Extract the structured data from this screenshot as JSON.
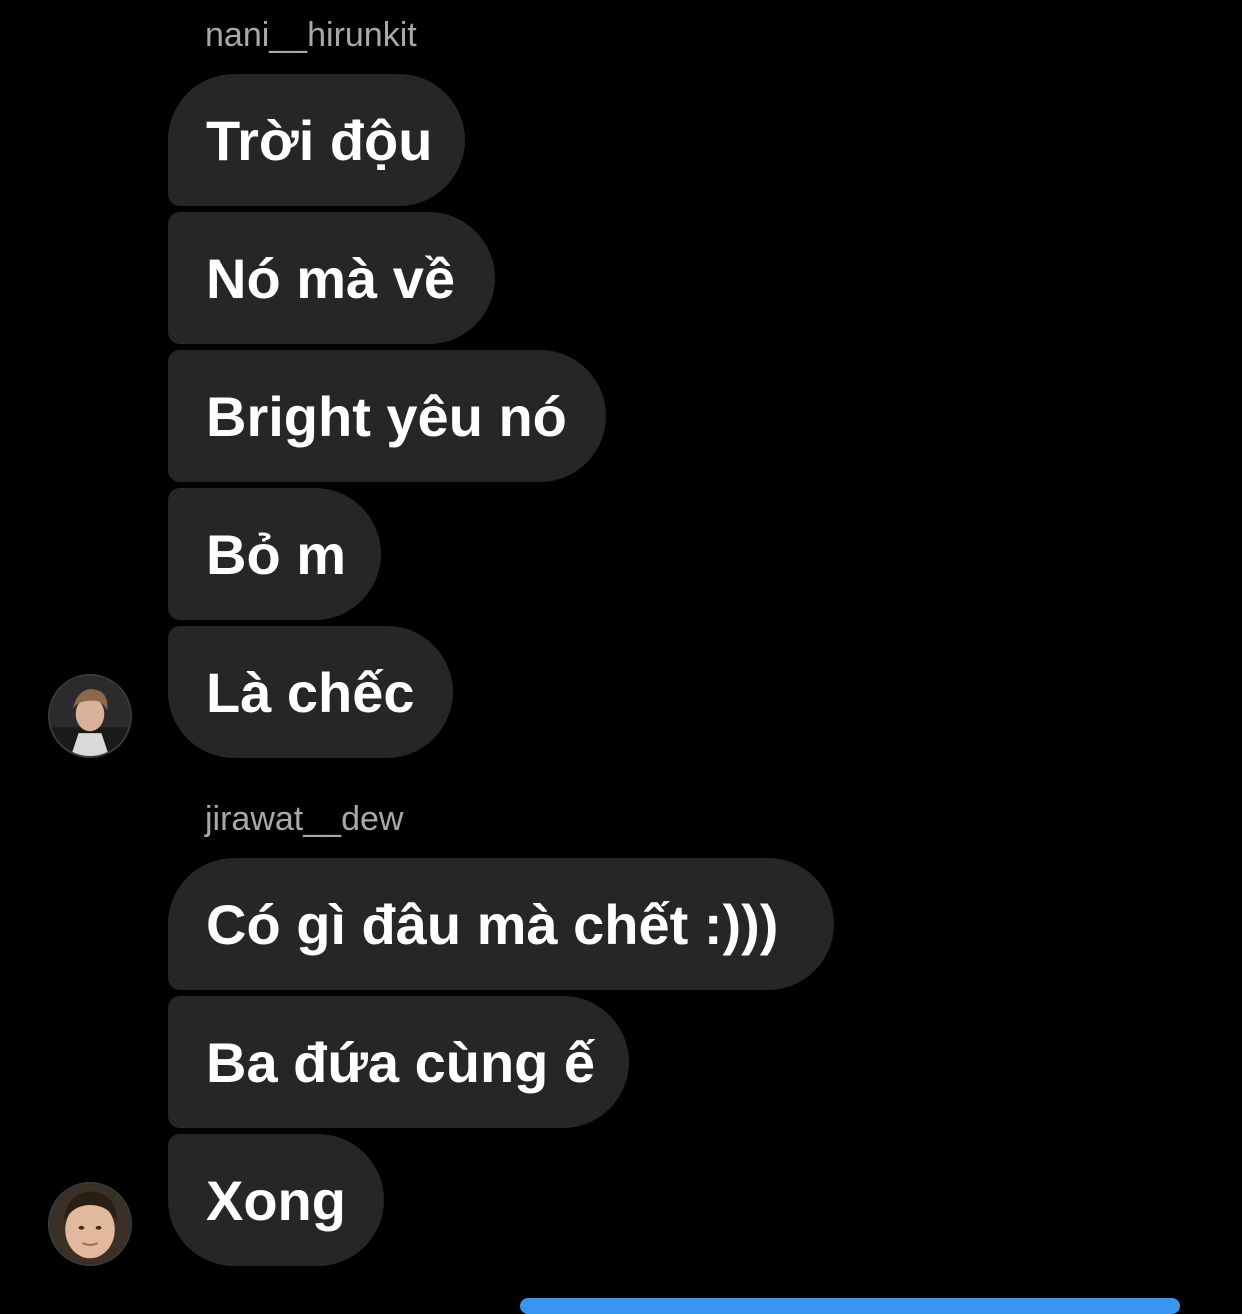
{
  "groups": [
    {
      "username": "nani__hirunkit",
      "messages": [
        "Trời độu",
        "Nó mà về",
        "Bright yêu nó",
        "Bỏ m",
        "Là chếc"
      ]
    },
    {
      "username": "jirawat__dew",
      "messages": [
        "Có gì đâu mà chết :)))",
        "Ba đứa cùng ế",
        "Xong"
      ]
    }
  ],
  "colors": {
    "background": "#000000",
    "bubble": "#262626",
    "username": "#a8a8a8",
    "accent": "#3797f0"
  }
}
